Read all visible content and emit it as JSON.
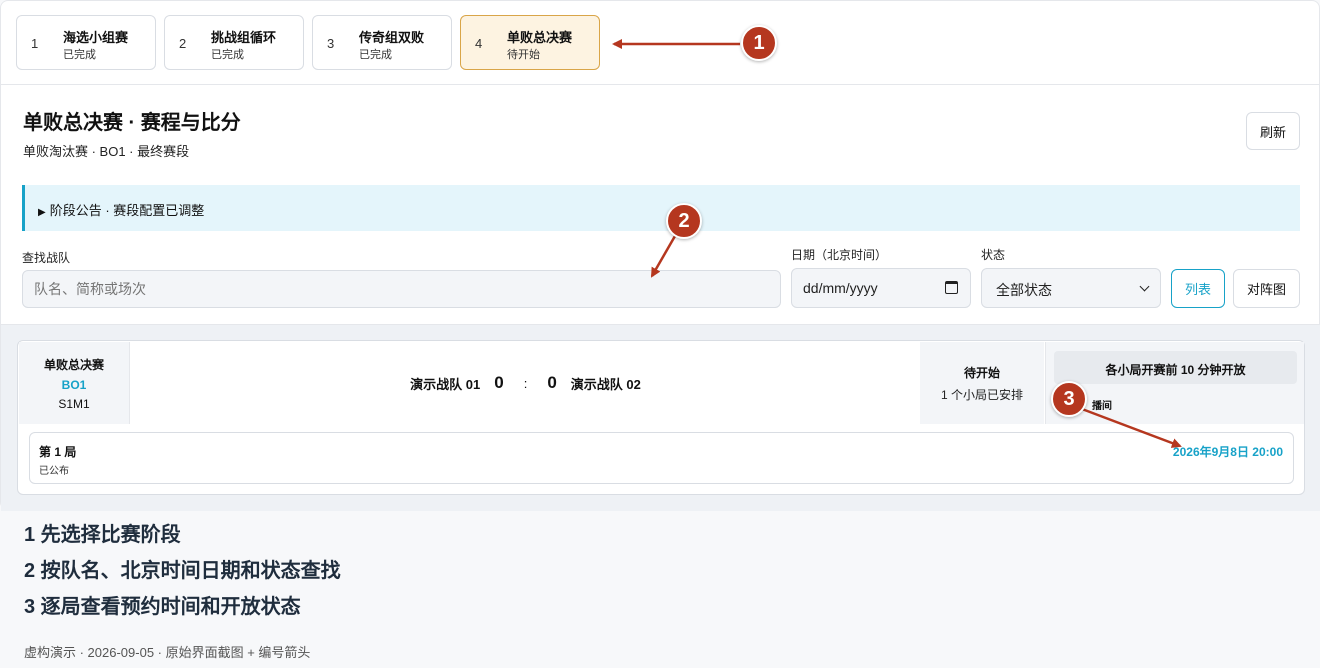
{
  "stages": [
    {
      "num": "1",
      "name": "海选小组赛",
      "status": "已完成"
    },
    {
      "num": "2",
      "name": "挑战组循环",
      "status": "已完成"
    },
    {
      "num": "3",
      "name": "传奇组双败",
      "status": "已完成"
    },
    {
      "num": "4",
      "name": "单败总决赛",
      "status": "待开始"
    }
  ],
  "header": {
    "title": "单败总决赛 · 赛程与比分",
    "subtitle": "单败淘汰赛 · BO1 · 最终赛段",
    "refresh_label": "刷新"
  },
  "notice": {
    "text": "阶段公告 · 赛段配置已调整"
  },
  "filters": {
    "search_label": "查找战队",
    "search_placeholder": "队名、简称或场次",
    "date_label": "日期（北京时间）",
    "date_value": "dd/mm/yyyy",
    "status_label": "状态",
    "status_value": "全部状态",
    "list_button": "列表",
    "bracket_button": "对阵图"
  },
  "match": {
    "stage": "单败总决赛",
    "format": "BO1",
    "code": "S1M1",
    "team_a": "演示战队 01",
    "score_a": "0",
    "separator": ":",
    "score_b": "0",
    "team_b": "演示战队 02",
    "status": "待开始",
    "status_detail": "1 个小局已安排",
    "info_header": "各小局开赛前 10 分钟开放",
    "room_label": "播间",
    "round_title": "第 1 局",
    "round_status": "已公布",
    "round_time": "2026年9月8日 20:00"
  },
  "callouts": [
    "1",
    "2",
    "3"
  ],
  "steps": [
    "1 先选择比赛阶段",
    "2 按队名、北京时间日期和状态查找",
    "3 逐局查看预约时间和开放状态"
  ],
  "footer": "虚构演示 · 2026-09-05 · 原始界面截图 + 编号箭头",
  "colors": {
    "accent": "#17a2c8",
    "callout": "#b5371f",
    "active_stage_bg": "#fdf3e1"
  }
}
